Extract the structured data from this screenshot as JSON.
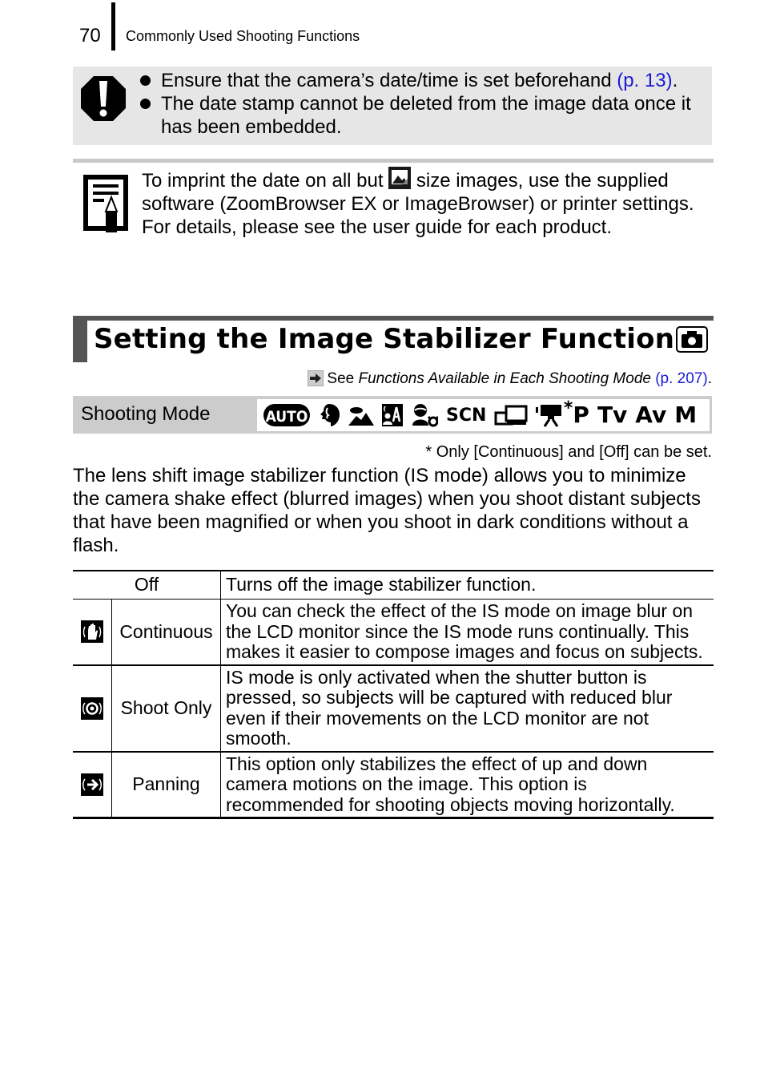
{
  "header": {
    "page_number": "70",
    "running_head": "Commonly Used Shooting Functions"
  },
  "caution": {
    "icon": "caution-icon",
    "items": [
      {
        "text": "Ensure that the camera’s date/time is set beforehand ",
        "link": "(p. 13)",
        "suffix": "."
      },
      {
        "text": "The date stamp cannot be deleted from the image data once it has been embedded.",
        "link": "",
        "suffix": ""
      }
    ]
  },
  "note": {
    "icon": "memo-pencil-icon",
    "text_before_icon": "To imprint the date on all but ",
    "inline_icon": "postcard-size-icon",
    "text_after_icon": " size images, use the supplied software (ZoomBrowser EX or ImageBrowser) or printer settings. For details, please see the user guide for each product."
  },
  "section": {
    "title": "Setting the Image Stabilizer Function",
    "title_icon": "camera-mode-icon",
    "see_also": {
      "icon": "arrow-right-icon",
      "prefix": "See ",
      "italic": "Functions Available in Each Shooting Mode",
      "link": "(p. 207)",
      "suffix": "."
    }
  },
  "shooting_mode": {
    "label": "Shooting Mode",
    "modes": [
      {
        "name": "auto",
        "label": "AUTO"
      },
      {
        "name": "portrait",
        "label": ""
      },
      {
        "name": "landscape",
        "label": ""
      },
      {
        "name": "night-snapshot",
        "label": ""
      },
      {
        "name": "kids-pets",
        "label": ""
      },
      {
        "name": "scene",
        "label": "SCN"
      },
      {
        "name": "stitch-assist",
        "label": ""
      },
      {
        "name": "movie",
        "label": "*"
      },
      {
        "name": "program",
        "label": "P"
      },
      {
        "name": "shutter-priority",
        "label": "Tv"
      },
      {
        "name": "aperture-priority",
        "label": "Av"
      },
      {
        "name": "manual",
        "label": "M"
      }
    ],
    "footnote": "* Only [Continuous] and [Off] can be set."
  },
  "body_text": "The lens shift image stabilizer function (IS mode) allows you to minimize the camera shake effect (blurred images) when you shoot distant subjects that have been magnified or when you shoot in dark conditions without a flash.",
  "table": {
    "rows": [
      {
        "icon": "",
        "name": "Off",
        "description": "Turns off the image stabilizer function."
      },
      {
        "icon": "is-continuous-icon",
        "name": "Continuous",
        "description": "You can check the effect of the IS mode on image blur on the LCD monitor since the IS mode runs continually. This makes it easier to compose images and focus on subjects."
      },
      {
        "icon": "is-shoot-only-icon",
        "name": "Shoot Only",
        "description": "IS mode is only activated when the shutter button is pressed, so subjects will be captured with reduced blur even if their movements on the LCD monitor are not smooth."
      },
      {
        "icon": "is-panning-icon",
        "name": "Panning",
        "description": "This option only stabilizes the effect of up and down camera motions on the image. This option is recommended for shooting objects moving horizontally."
      }
    ]
  }
}
